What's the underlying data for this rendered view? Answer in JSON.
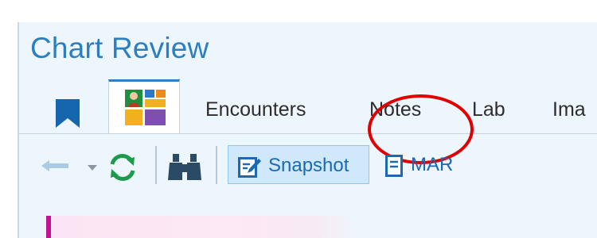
{
  "header": {
    "title": "Chart Review"
  },
  "tabs": [
    {
      "icon": "bookmark-icon",
      "label": ""
    },
    {
      "icon": "chart-review-grid-icon",
      "label": "",
      "selected": true
    },
    {
      "label": "Encounters"
    },
    {
      "label": "Notes",
      "annotated": true
    },
    {
      "label": "Lab"
    },
    {
      "label": "Ima"
    }
  ],
  "toolbar": {
    "snapshot_label": "Snapshot",
    "mar_label": "MAR"
  },
  "colors": {
    "title": "#2b7fc1",
    "accent": "#2e7fc4",
    "annotation": "#e00000",
    "refresh": "#1d9a4c",
    "content_marker": "#c3138f"
  }
}
